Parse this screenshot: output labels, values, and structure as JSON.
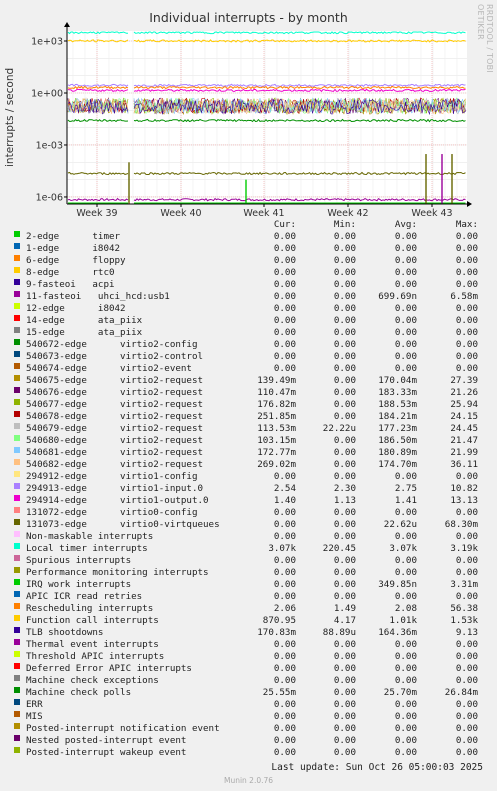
{
  "chart_data": {
    "type": "line",
    "title": "Individual interrupts - by month",
    "side_label": "RRDTOOL / TOBI OETIKER",
    "ylabel": "interrupts / second",
    "yscale": "log",
    "y_ticks": [
      "1e+03",
      "1e+00",
      "1e-03",
      "1e-06"
    ],
    "x_ticks": [
      "Week 39",
      "Week 40",
      "Week 41",
      "Week 42",
      "Week 43"
    ],
    "grid": true,
    "columns": [
      "Cur:",
      "Min:",
      "Avg:",
      "Max:"
    ],
    "series": [
      {
        "name": "2-edge      timer",
        "color": "#00cc00",
        "cur": "0.00",
        "min": "0.00",
        "avg": "0.00",
        "max": "0.00"
      },
      {
        "name": "1-edge      i8042",
        "color": "#0066b3",
        "cur": "0.00",
        "min": "0.00",
        "avg": "0.00",
        "max": "0.00"
      },
      {
        "name": "6-edge      floppy",
        "color": "#ff8000",
        "cur": "0.00",
        "min": "0.00",
        "avg": "0.00",
        "max": "0.00"
      },
      {
        "name": "8-edge      rtc0",
        "color": "#ffcc00",
        "cur": "0.00",
        "min": "0.00",
        "avg": "0.00",
        "max": "0.00"
      },
      {
        "name": "9-fasteoi   acpi",
        "color": "#330099",
        "cur": "0.00",
        "min": "0.00",
        "avg": "0.00",
        "max": "0.00"
      },
      {
        "name": "11-fasteoi   uhci_hcd:usb1",
        "color": "#990099",
        "cur": "0.00",
        "min": "0.00",
        "avg": "699.69n",
        "max": "6.58m"
      },
      {
        "name": "12-edge      i8042",
        "color": "#ccff00",
        "cur": "0.00",
        "min": "0.00",
        "avg": "0.00",
        "max": "0.00"
      },
      {
        "name": "14-edge      ata_piix",
        "color": "#ff0000",
        "cur": "0.00",
        "min": "0.00",
        "avg": "0.00",
        "max": "0.00"
      },
      {
        "name": "15-edge      ata_piix",
        "color": "#808080",
        "cur": "0.00",
        "min": "0.00",
        "avg": "0.00",
        "max": "0.00"
      },
      {
        "name": "540672-edge      virtio2-config",
        "color": "#008f00",
        "cur": "0.00",
        "min": "0.00",
        "avg": "0.00",
        "max": "0.00"
      },
      {
        "name": "540673-edge      virtio2-control",
        "color": "#00487d",
        "cur": "0.00",
        "min": "0.00",
        "avg": "0.00",
        "max": "0.00"
      },
      {
        "name": "540674-edge      virtio2-event",
        "color": "#b35a00",
        "cur": "0.00",
        "min": "0.00",
        "avg": "0.00",
        "max": "0.00"
      },
      {
        "name": "540675-edge      virtio2-request",
        "color": "#b38f00",
        "cur": "139.49m",
        "min": "0.00",
        "avg": "170.04m",
        "max": "27.39"
      },
      {
        "name": "540676-edge      virtio2-request",
        "color": "#6b006b",
        "cur": "110.47m",
        "min": "0.00",
        "avg": "183.33m",
        "max": "21.26"
      },
      {
        "name": "540677-edge      virtio2-request",
        "color": "#8fb300",
        "cur": "176.82m",
        "min": "0.00",
        "avg": "188.53m",
        "max": "25.94"
      },
      {
        "name": "540678-edge      virtio2-request",
        "color": "#b30000",
        "cur": "251.85m",
        "min": "0.00",
        "avg": "184.21m",
        "max": "24.15"
      },
      {
        "name": "540679-edge      virtio2-request",
        "color": "#bebebe",
        "cur": "113.53m",
        "min": "22.22u",
        "avg": "177.23m",
        "max": "24.45"
      },
      {
        "name": "540680-edge      virtio2-request",
        "color": "#80ff80",
        "cur": "103.15m",
        "min": "0.00",
        "avg": "186.50m",
        "max": "21.47"
      },
      {
        "name": "540681-edge      virtio2-request",
        "color": "#80c9ff",
        "cur": "172.77m",
        "min": "0.00",
        "avg": "180.89m",
        "max": "21.99"
      },
      {
        "name": "540682-edge      virtio2-request",
        "color": "#ffc080",
        "cur": "269.02m",
        "min": "0.00",
        "avg": "174.70m",
        "max": "36.11"
      },
      {
        "name": "294912-edge      virtio1-config",
        "color": "#ffe680",
        "cur": "0.00",
        "min": "0.00",
        "avg": "0.00",
        "max": "0.00"
      },
      {
        "name": "294913-edge      virtio1-input.0",
        "color": "#aa80ff",
        "cur": "2.54",
        "min": "2.30",
        "avg": "2.75",
        "max": "10.82"
      },
      {
        "name": "294914-edge      virtio1-output.0",
        "color": "#ee00cc",
        "cur": "1.40",
        "min": "1.13",
        "avg": "1.41",
        "max": "13.13"
      },
      {
        "name": "131072-edge      virtio0-config",
        "color": "#ff8080",
        "cur": "0.00",
        "min": "0.00",
        "avg": "0.00",
        "max": "0.00"
      },
      {
        "name": "131073-edge      virtio0-virtqueues",
        "color": "#666600",
        "cur": "0.00",
        "min": "0.00",
        "avg": "22.62u",
        "max": "68.30m"
      },
      {
        "name": "Non-maskable interrupts",
        "color": "#ffbfff",
        "cur": "0.00",
        "min": "0.00",
        "avg": "0.00",
        "max": "0.00"
      },
      {
        "name": "Local timer interrupts",
        "color": "#00ffcc",
        "cur": "3.07k",
        "min": "220.45",
        "avg": "3.07k",
        "max": "3.19k"
      },
      {
        "name": "Spurious interrupts",
        "color": "#cc6699",
        "cur": "0.00",
        "min": "0.00",
        "avg": "0.00",
        "max": "0.00"
      },
      {
        "name": "Performance monitoring interrupts",
        "color": "#999900",
        "cur": "0.00",
        "min": "0.00",
        "avg": "0.00",
        "max": "0.00"
      },
      {
        "name": "IRQ work interrupts",
        "color": "#00cc00",
        "cur": "0.00",
        "min": "0.00",
        "avg": "349.85n",
        "max": "3.31m"
      },
      {
        "name": "APIC ICR read retries",
        "color": "#0066b3",
        "cur": "0.00",
        "min": "0.00",
        "avg": "0.00",
        "max": "0.00"
      },
      {
        "name": "Rescheduling interrupts",
        "color": "#ff8000",
        "cur": "2.06",
        "min": "1.49",
        "avg": "2.08",
        "max": "56.38"
      },
      {
        "name": "Function call interrupts",
        "color": "#ffcc00",
        "cur": "870.95",
        "min": "4.17",
        "avg": "1.01k",
        "max": "1.53k"
      },
      {
        "name": "TLB shootdowns",
        "color": "#330099",
        "cur": "170.83m",
        "min": "88.89u",
        "avg": "164.36m",
        "max": "9.13"
      },
      {
        "name": "Thermal event interrupts",
        "color": "#990099",
        "cur": "0.00",
        "min": "0.00",
        "avg": "0.00",
        "max": "0.00"
      },
      {
        "name": "Threshold APIC interrupts",
        "color": "#ccff00",
        "cur": "0.00",
        "min": "0.00",
        "avg": "0.00",
        "max": "0.00"
      },
      {
        "name": "Deferred Error APIC interrupts",
        "color": "#ff0000",
        "cur": "0.00",
        "min": "0.00",
        "avg": "0.00",
        "max": "0.00"
      },
      {
        "name": "Machine check exceptions",
        "color": "#808080",
        "cur": "0.00",
        "min": "0.00",
        "avg": "0.00",
        "max": "0.00"
      },
      {
        "name": "Machine check polls",
        "color": "#008f00",
        "cur": "25.55m",
        "min": "0.00",
        "avg": "25.70m",
        "max": "26.84m"
      },
      {
        "name": "ERR",
        "color": "#00487d",
        "cur": "0.00",
        "min": "0.00",
        "avg": "0.00",
        "max": "0.00"
      },
      {
        "name": "MIS",
        "color": "#b35a00",
        "cur": "0.00",
        "min": "0.00",
        "avg": "0.00",
        "max": "0.00"
      },
      {
        "name": "Posted-interrupt notification event",
        "color": "#b38f00",
        "cur": "0.00",
        "min": "0.00",
        "avg": "0.00",
        "max": "0.00"
      },
      {
        "name": "Nested posted-interrupt event",
        "color": "#6b006b",
        "cur": "0.00",
        "min": "0.00",
        "avg": "0.00",
        "max": "0.00"
      },
      {
        "name": "Posted-interrupt wakeup event",
        "color": "#8fb300",
        "cur": "0.00",
        "min": "0.00",
        "avg": "0.00",
        "max": "0.00"
      }
    ]
  },
  "last_update": "Last update: Sun Oct 26 05:00:03 2025",
  "footer": "Munin 2.0.76"
}
